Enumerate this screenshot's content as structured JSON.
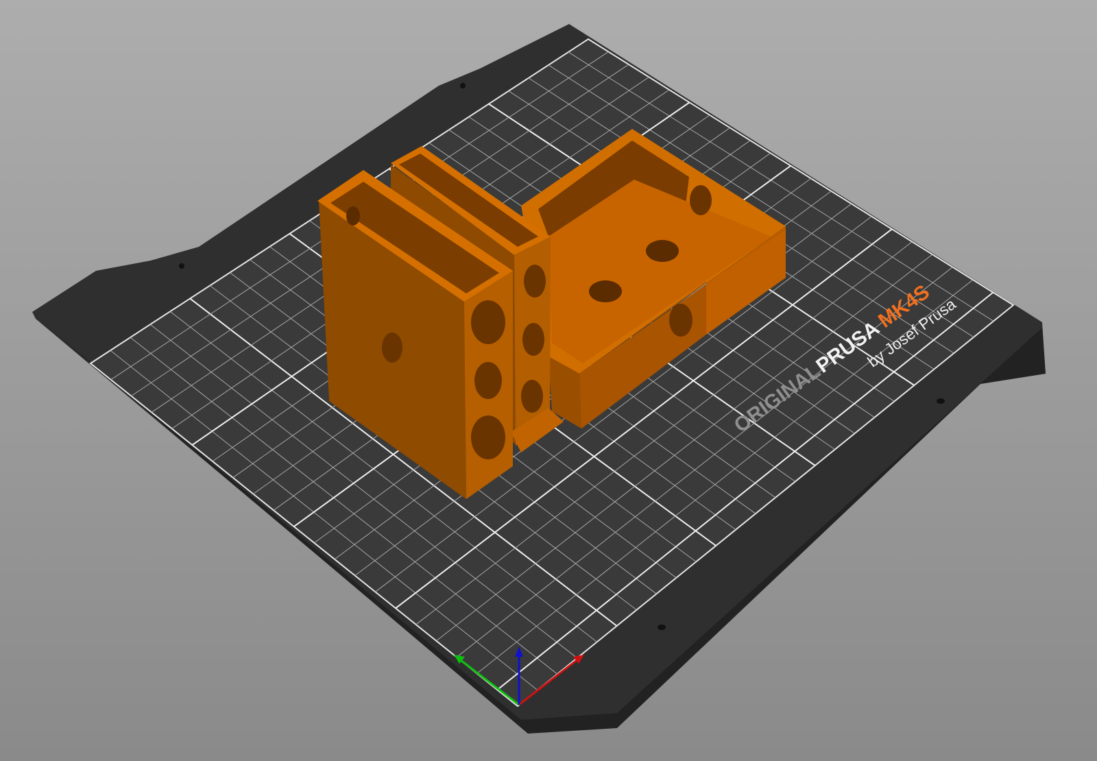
{
  "scene": {
    "bed_logo": {
      "original": "ORIGINAL",
      "brand": "PRUSA",
      "model": "MK4S",
      "byline": "by Josef Prusa"
    },
    "colors": {
      "background_top": "#adadad",
      "background_bottom": "#8a8a8a",
      "plate": "#333333",
      "grid_line": "#d8d8d8",
      "object": "#cc6a00",
      "logo_accent": "#f07020",
      "axis_x": "#d01010",
      "axis_y": "#10c010",
      "axis_z": "#1010d0"
    }
  }
}
